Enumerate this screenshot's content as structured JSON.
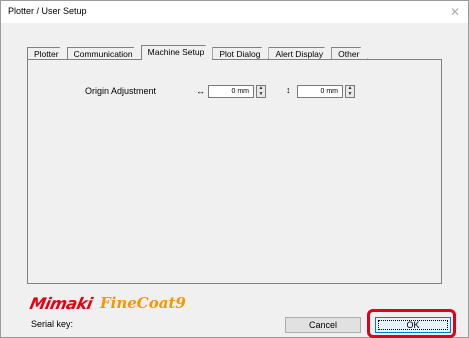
{
  "window": {
    "title": "Plotter / User Setup",
    "close_glyph": "✕"
  },
  "tabs": [
    {
      "label": "Plotter",
      "active": false
    },
    {
      "label": "Communication",
      "active": false
    },
    {
      "label": "Machine Setup",
      "active": true
    },
    {
      "label": "Plot Dialog",
      "active": false
    },
    {
      "label": "Alert Display",
      "active": false
    },
    {
      "label": "Other",
      "active": false
    }
  ],
  "machine_setup": {
    "origin_label": "Origin Adjustment",
    "horizontal_arrow": "↔",
    "vertical_arrow": "↕",
    "origin_x_value": "0 mm",
    "origin_y_value": "0 mm"
  },
  "branding": {
    "logo_brand": "Mimaki",
    "logo_product": "FineCoat9",
    "brand_color": "#e60012",
    "product_color": "#f39800"
  },
  "serial_label": "Serial key:",
  "buttons": {
    "cancel_label": "Cancel",
    "ok_label": "OK"
  },
  "highlight_color": "#e30016"
}
